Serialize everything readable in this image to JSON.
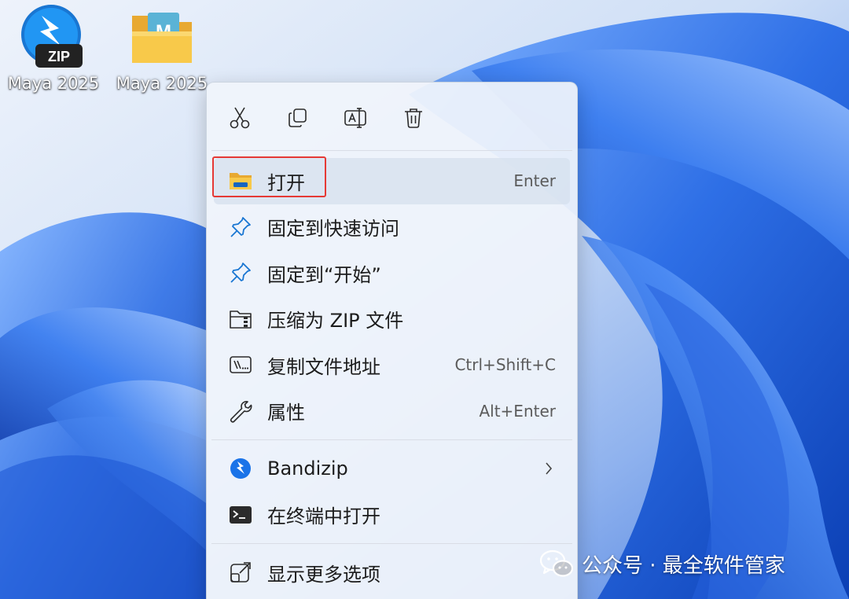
{
  "desktop": {
    "icons": [
      {
        "label": "Maya 2025",
        "badge": "ZIP",
        "icon": "bandizip-archive-icon"
      },
      {
        "label": "Maya 2025",
        "badge": "M",
        "icon": "folder-icon"
      }
    ]
  },
  "context_menu": {
    "quick_actions": [
      {
        "name": "cut",
        "icon": "scissors-icon"
      },
      {
        "name": "copy",
        "icon": "copy-icon"
      },
      {
        "name": "rename",
        "icon": "rename-icon"
      },
      {
        "name": "delete",
        "icon": "trash-icon"
      }
    ],
    "items": [
      {
        "label": "打开",
        "shortcut": "Enter",
        "icon": "folder-open-icon",
        "highlighted": true
      },
      {
        "label": "固定到快速访问",
        "icon": "pin-icon"
      },
      {
        "label": "固定到“开始”",
        "icon": "pin-icon"
      },
      {
        "label": "压缩为 ZIP 文件",
        "icon": "zip-folder-icon"
      },
      {
        "label": "复制文件地址",
        "shortcut": "Ctrl+Shift+C",
        "icon": "copy-path-icon"
      },
      {
        "label": "属性",
        "shortcut": "Alt+Enter",
        "icon": "wrench-icon"
      }
    ],
    "items_group2": [
      {
        "label": "Bandizip",
        "icon": "bandizip-icon",
        "has_submenu": true
      },
      {
        "label": "在终端中打开",
        "icon": "terminal-icon"
      }
    ],
    "items_group3": [
      {
        "label": "显示更多选项",
        "icon": "show-more-icon"
      }
    ]
  },
  "watermark": {
    "text": "公众号 · 最全软件管家",
    "icon": "wechat-icon"
  },
  "colors": {
    "highlight_box": "#e53935",
    "bandizip_blue": "#1a73e8",
    "folder_yellow": "#f6c443"
  }
}
